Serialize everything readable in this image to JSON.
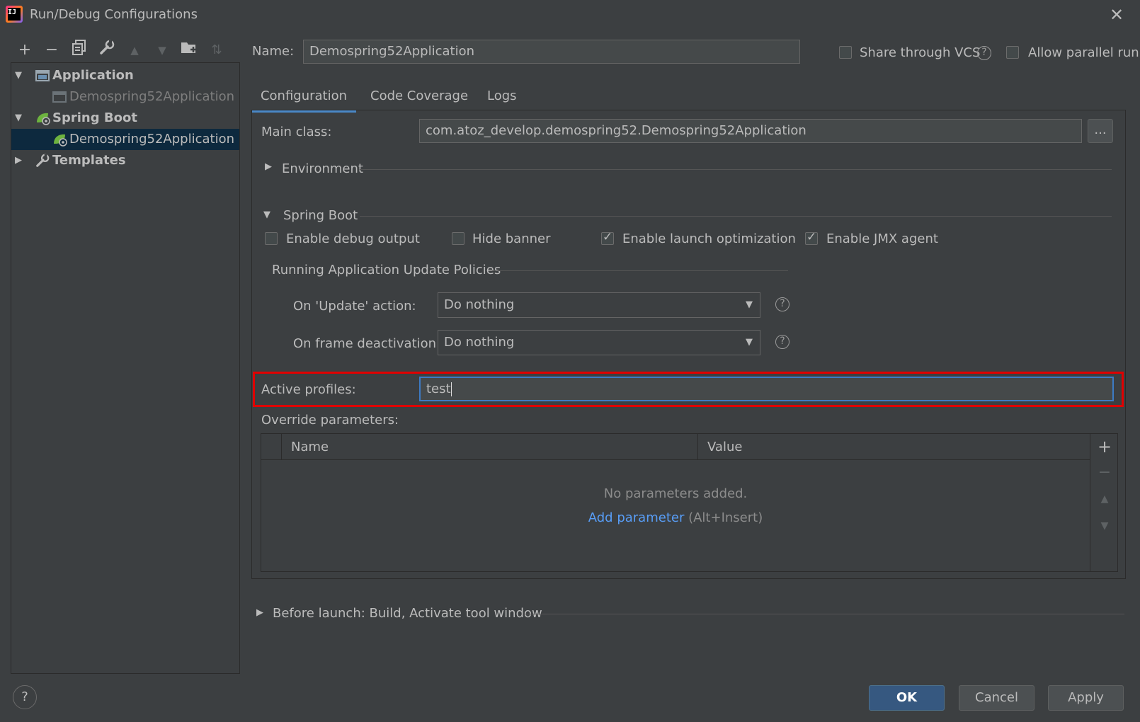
{
  "window": {
    "title": "Run/Debug Configurations"
  },
  "toolbar": {
    "add": "+",
    "remove": "−",
    "copy": "⧉",
    "edit": "🔧",
    "up": "▲",
    "down": "▼",
    "folder": "📁",
    "sort": "⇅"
  },
  "tree": {
    "items": [
      {
        "label": "Application",
        "bold": true
      },
      {
        "label": "Demospring52Application",
        "muted": true
      },
      {
        "label": "Spring Boot",
        "bold": true
      },
      {
        "label": "Demospring52Application",
        "selected": true
      },
      {
        "label": "Templates",
        "bold": true
      }
    ]
  },
  "header": {
    "name_label": "Name:",
    "name_value": "Demospring52Application",
    "share_vcs": "Share through VCS",
    "allow_parallel": "Allow parallel run"
  },
  "tabs": [
    {
      "label": "Configuration",
      "active": true
    },
    {
      "label": "Code Coverage"
    },
    {
      "label": "Logs"
    }
  ],
  "config": {
    "main_class_label": "Main class:",
    "main_class_value": "com.atoz_develop.demospring52.Demospring52Application",
    "browse_label": "...",
    "environment_label": "Environment",
    "spring_boot_label": "Spring Boot",
    "enable_debug": "Enable debug output",
    "hide_banner": "Hide banner",
    "enable_launch_opt": "Enable launch optimization",
    "enable_jmx": "Enable JMX agent",
    "policies_label": "Running Application Update Policies",
    "on_update_label": "On 'Update' action:",
    "on_update_value": "Do nothing",
    "on_frame_label": "On frame deactivation:",
    "on_frame_value": "Do nothing",
    "active_profiles_label": "Active profiles:",
    "active_profiles_value": "test",
    "override_label": "Override parameters:",
    "col_name": "Name",
    "col_value": "Value",
    "empty_msg": "No parameters added.",
    "add_param_link": "Add parameter",
    "add_param_shortcut": "(Alt+Insert)"
  },
  "before_launch": "Before launch: Build, Activate tool window",
  "buttons": {
    "ok": "OK",
    "cancel": "Cancel",
    "apply": "Apply"
  },
  "help_symbol": "?"
}
